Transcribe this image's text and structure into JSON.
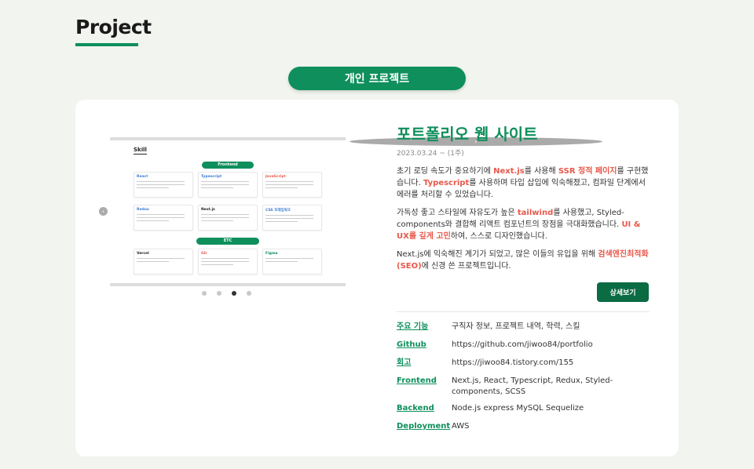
{
  "section": {
    "title": "Project"
  },
  "category_pill": "개인 프로젝트",
  "carousel": {
    "prev_icon": "‹",
    "next_icon": "›",
    "slide": {
      "heading": "Skill",
      "groups": [
        "Frontend",
        "ETC"
      ],
      "cards": [
        "React",
        "Typescript",
        "JavaScript",
        "Redux",
        "Next.js",
        "CSS 프레임워크",
        "Vercel",
        "Git",
        "Figma"
      ]
    },
    "dot_count": 4,
    "active_dot": 2
  },
  "project": {
    "title": "포트폴리오 웹 사이트",
    "date": "2023.03.24 ~ (1주)",
    "paragraphs": [
      [
        {
          "t": "초기 로딩 속도가 중요하기에 "
        },
        {
          "t": "Next.js",
          "h": true
        },
        {
          "t": "를 사용해 "
        },
        {
          "t": "SSR 정적 페이지",
          "h": true
        },
        {
          "t": "를 구현했습니다. "
        },
        {
          "t": "Typescript",
          "h": true
        },
        {
          "t": "를 사용하며 타입 삽입에 익숙해졌고, 컴파일 단계에서 에러를 처리할 수 있었습니다."
        }
      ],
      [
        {
          "t": "가독성 좋고 스타일에 자유도가 높은 "
        },
        {
          "t": "tailwind",
          "h": true
        },
        {
          "t": "를 사용했고, Styled-components와 결합해 리액트 컴포넌트의 장점을 극대화했습니다. "
        },
        {
          "t": "UI & UX를 깊게 고민",
          "h": true
        },
        {
          "t": "하여, 스스로 디자인했습니다."
        }
      ],
      [
        {
          "t": "Next.js에 익숙해진 계기가 되었고, 많은 이들의 유입을 위해 "
        },
        {
          "t": "검색엔진최적화(SEO)",
          "h": true
        },
        {
          "t": "에 신경 쓴 프로젝트입니다."
        }
      ]
    ],
    "detail_button": "상세보기",
    "info": [
      {
        "key": "주요 기능",
        "value": "구직자 정보, 프로젝트 내역, 학력, 스킬"
      },
      {
        "key": "Github",
        "value": "https://github.com/jiwoo84/portfolio"
      },
      {
        "key": "회고",
        "value": "https://jiwoo84.tistory.com/155"
      },
      {
        "key": "Frontend",
        "value": "Next.js, React, Typescript, Redux, Styled-components, SCSS"
      },
      {
        "key": "Backend",
        "value": "Node.js express MySQL Sequelize"
      },
      {
        "key": "Deployment",
        "value": "AWS"
      }
    ]
  },
  "colors": {
    "accent": "#0e8f5c",
    "highlight": "#e8584a",
    "button": "#0b6b43"
  }
}
